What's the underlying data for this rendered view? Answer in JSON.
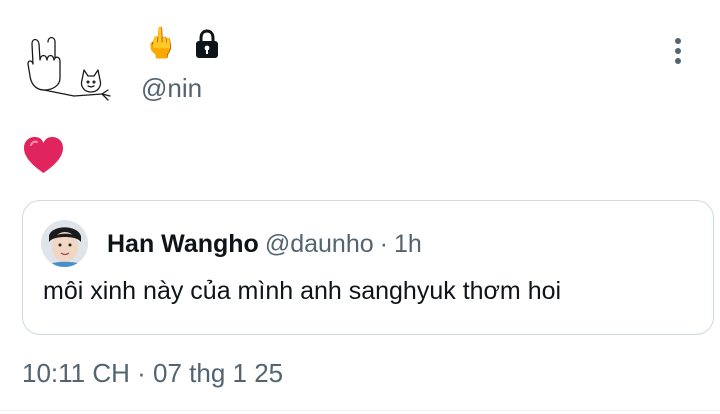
{
  "tweet": {
    "author_handle": "@nin",
    "author_name_icons": [
      "pointing-finger-icon",
      "lock-icon"
    ],
    "body_emoji_icon": "red-heart-icon",
    "quoted": {
      "name": "Han Wangho",
      "handle": "@daunho",
      "separator": "·",
      "relative_time": "1h",
      "text": "môi xinh này của mình anh sanghyuk thơm hoi"
    },
    "timestamp": "10:11 CH · 07 thg 1 25"
  },
  "colors": {
    "text_primary": "#0f1419",
    "text_secondary": "#536471",
    "border": "#cfd9de",
    "heart": "#e0245e"
  }
}
